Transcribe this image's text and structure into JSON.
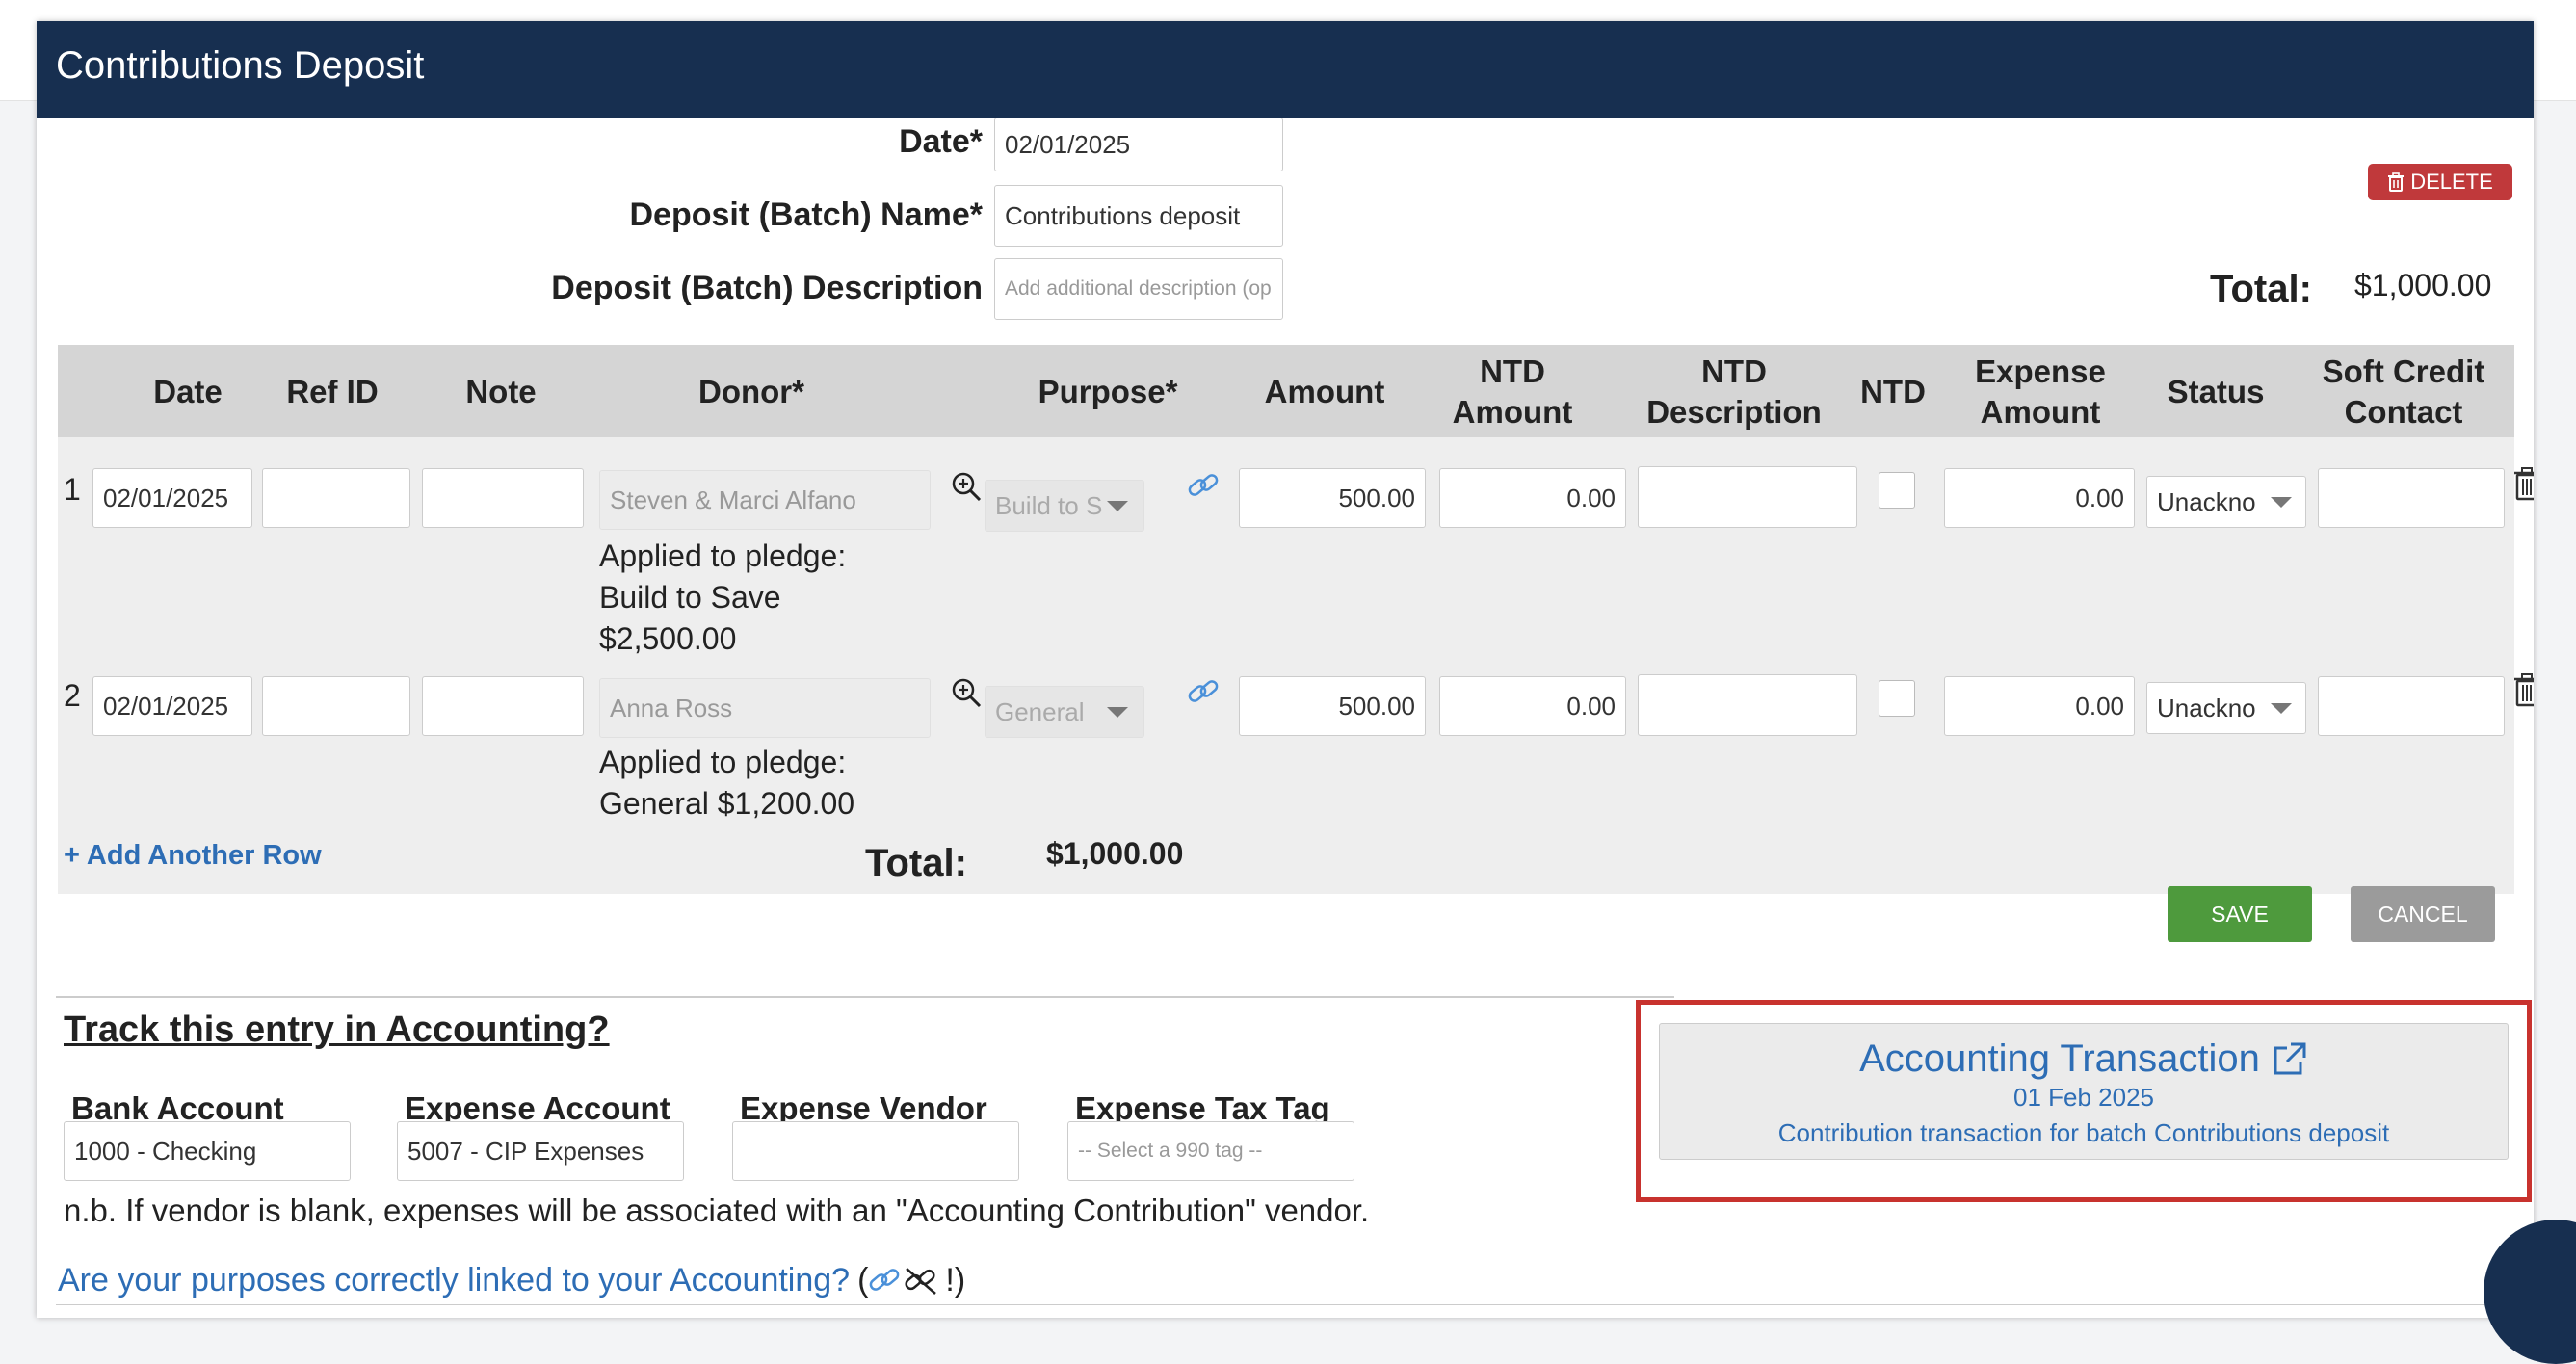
{
  "modal": {
    "title": "Contributions Deposit"
  },
  "batch": {
    "date_label": "Date*",
    "date_value": "02/01/2025",
    "name_label": "Deposit (Batch) Name*",
    "name_value": "Contributions deposit",
    "desc_label": "Deposit (Batch) Description",
    "desc_placeholder": "Add additional description (op",
    "delete_label": "DELETE",
    "total_label": "Total:",
    "total_value": "$1,000.00"
  },
  "table": {
    "headers": {
      "date": "Date",
      "ref_id": "Ref ID",
      "note": "Note",
      "donor": "Donor*",
      "purpose": "Purpose*",
      "amount": "Amount",
      "ntd_amount_1": "NTD",
      "ntd_amount_2": "Amount",
      "ntd_desc_1": "NTD",
      "ntd_desc_2": "Description",
      "ntd": "NTD",
      "expense_amount_1": "Expense",
      "expense_amount_2": "Amount",
      "status": "Status",
      "soft_credit_1": "Soft Credit",
      "soft_credit_2": "Contact"
    },
    "rows": [
      {
        "num": "1",
        "date": "02/01/2025",
        "donor": "Steven & Marci Alfano",
        "purpose": "Build to S",
        "amount": "500.00",
        "ntd_amount": "0.00",
        "expense_amount": "0.00",
        "status": "Unackno",
        "pledge_line1": "Applied to pledge:",
        "pledge_line2": "Build to Save",
        "pledge_line3": "$2,500.00"
      },
      {
        "num": "2",
        "date": "02/01/2025",
        "donor": "Anna Ross",
        "purpose": "General",
        "amount": "500.00",
        "ntd_amount": "0.00",
        "expense_amount": "0.00",
        "status": "Unackno",
        "pledge_line1": "Applied to pledge:",
        "pledge_line2": "General $1,200.00"
      }
    ],
    "add_row_label": "+ Add Another Row",
    "total_label": "Total:",
    "total_value": "$1,000.00"
  },
  "actions": {
    "save_label": "SAVE",
    "cancel_label": "CANCEL"
  },
  "accounting": {
    "heading": "Track this entry in Accounting?",
    "bank_account_label": "Bank Account",
    "bank_account_value": "1000 - Checking",
    "expense_account_label": "Expense Account",
    "expense_account_value": "5007 - CIP Expenses",
    "expense_vendor_label": "Expense Vendor",
    "expense_vendor_value": "",
    "expense_tax_tag_label": "Expense Tax Tag",
    "expense_tax_tag_placeholder": "-- Select a 990 tag --",
    "note": "n.b. If vendor is blank, expenses will be associated with an \"Accounting Contribution\" vendor.",
    "purposes_link": "Are your purposes correctly linked to your Accounting?",
    "paren_open": "(",
    "paren_close": "!)",
    "transaction_title": "Accounting Transaction",
    "transaction_date": "01 Feb 2025",
    "transaction_desc": "Contribution transaction for batch Contributions deposit"
  },
  "icons": {
    "zoom": "magnifier-plus-icon",
    "link": "link-icon",
    "trash": "trash-icon",
    "external": "external-link-icon",
    "unlink": "unlink-icon"
  },
  "colors": {
    "header": "#172f50",
    "delete": "#c0393b",
    "save": "#4e9a3d",
    "cancel": "#9b9b9b",
    "link": "#2d6db5",
    "highlight": "#c8322e"
  }
}
